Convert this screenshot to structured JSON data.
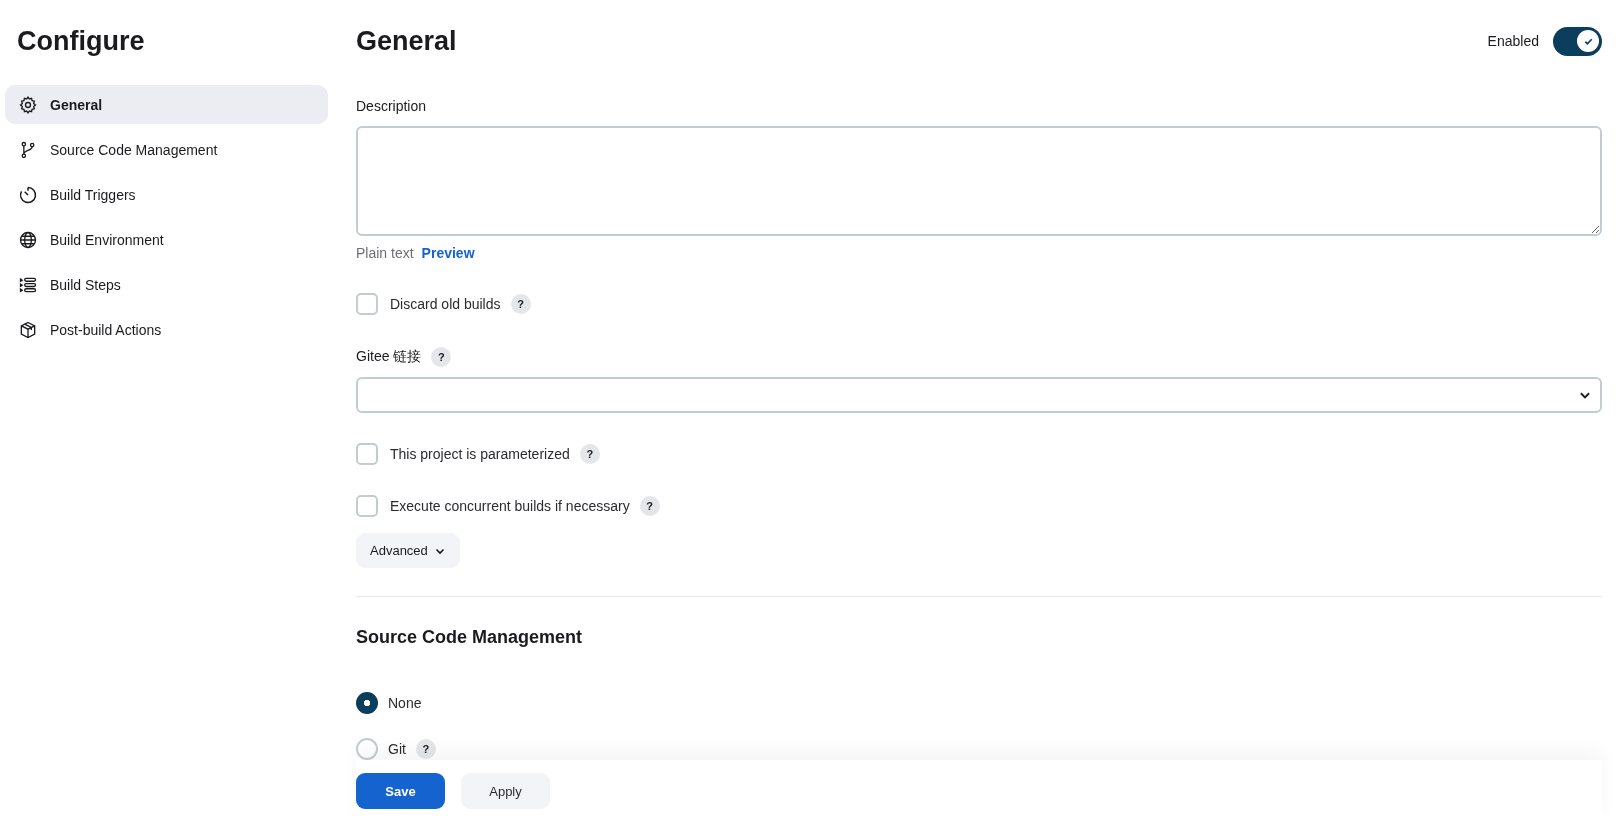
{
  "sidebar": {
    "title": "Configure",
    "items": [
      {
        "label": "General",
        "selected": true
      },
      {
        "label": "Source Code Management",
        "selected": false
      },
      {
        "label": "Build Triggers",
        "selected": false
      },
      {
        "label": "Build Environment",
        "selected": false
      },
      {
        "label": "Build Steps",
        "selected": false
      },
      {
        "label": "Post-build Actions",
        "selected": false
      }
    ]
  },
  "general": {
    "title": "General",
    "enabled": {
      "label": "Enabled",
      "on": true
    },
    "description": {
      "label": "Description",
      "format": "Plain text",
      "preview_link": "Preview"
    },
    "discard_old_builds": {
      "label": "Discard old builds",
      "checked": false,
      "help": "?"
    },
    "gitee": {
      "label": "Gitee 链接",
      "help": "?"
    },
    "options": [
      {
        "label": "This project is parameterized",
        "checked": false,
        "help": "?"
      },
      {
        "label": "Execute concurrent builds if necessary",
        "checked": false,
        "help": "?"
      }
    ],
    "advanced_button": "Advanced"
  },
  "source_code_management": {
    "title": "Source Code Management",
    "options": [
      {
        "label": "None",
        "selected": true
      },
      {
        "label": "Git",
        "selected": false,
        "help": "?"
      }
    ]
  },
  "footer": {
    "save": "Save",
    "apply": "Apply"
  }
}
